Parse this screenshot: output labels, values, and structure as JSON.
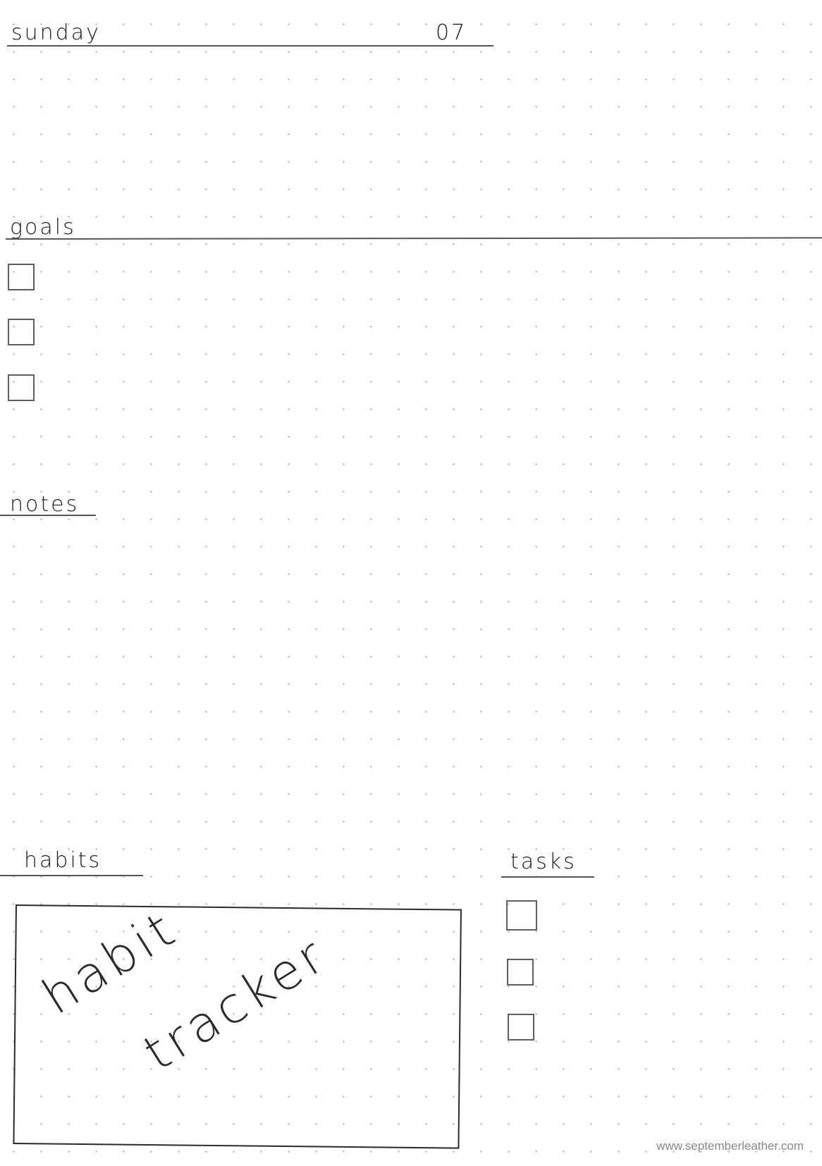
{
  "header": {
    "day": "sunday",
    "date": "07"
  },
  "sections": {
    "goals": {
      "title": "goals",
      "checkbox_count": 3
    },
    "notes": {
      "title": "notes"
    },
    "habits": {
      "title": "habits",
      "tracker_words": [
        "habit",
        "tracker"
      ]
    },
    "tasks": {
      "title": "tasks",
      "checkbox_count": 3
    }
  },
  "footer": {
    "url": "www.septemberleather.com"
  },
  "colors": {
    "ink": "#1e1e1e",
    "rule": "#555555",
    "dot": "#b5b5b5",
    "footer": "#888888"
  }
}
